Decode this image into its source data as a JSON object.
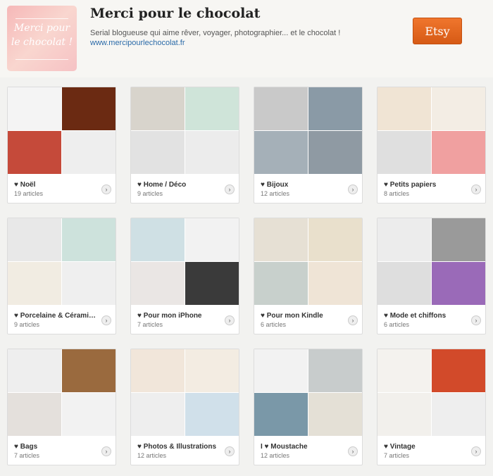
{
  "shop": {
    "avatar_text_1": "Merci pour",
    "avatar_text_2": "le chocolat !",
    "title": "Merci pour le chocolat",
    "description": "Serial blogueuse qui aime rêver, voyager, photographier... et le chocolat !",
    "link": "www.mercipourlechocolat.fr",
    "etsy_label": "Etsy"
  },
  "collections": [
    {
      "title": "♥ Noël",
      "count": "19 articles",
      "colors": [
        "#f4f4f4",
        "#6b2a12",
        "#c54a3a",
        "#eeeeee"
      ]
    },
    {
      "title": "♥ Home / Déco",
      "count": "9 articles",
      "colors": [
        "#d8d4cc",
        "#cfe4d9",
        "#e2e2e2",
        "#ececec"
      ]
    },
    {
      "title": "♥ Bijoux",
      "count": "12 articles",
      "colors": [
        "#c9c9c9",
        "#8a9aa6",
        "#a5b0b8",
        "#8f9aa3"
      ]
    },
    {
      "title": "♥ Petits papiers",
      "count": "8 articles",
      "colors": [
        "#f0e4d4",
        "#f3ede4",
        "#dfdfdf",
        "#f0a0a0"
      ]
    },
    {
      "title": "♥ Porcelaine & Cérami…",
      "count": "9 articles",
      "colors": [
        "#e8e8e8",
        "#cde2dc",
        "#f1ece2",
        "#efefef"
      ]
    },
    {
      "title": "♥ Pour mon iPhone",
      "count": "7 articles",
      "colors": [
        "#cfe0e4",
        "#f2f2f2",
        "#eae6e4",
        "#3a3a3a"
      ]
    },
    {
      "title": "♥ Pour mon Kindle",
      "count": "6 articles",
      "colors": [
        "#e6e0d4",
        "#e9e0cc",
        "#c8d0cc",
        "#efe4d6"
      ]
    },
    {
      "title": "♥ Mode et chiffons",
      "count": "6 articles",
      "colors": [
        "#ececec",
        "#9a9a9a",
        "#dedede",
        "#9a6ab8"
      ]
    },
    {
      "title": "♥ Bags",
      "count": "7 articles",
      "colors": [
        "#eeeeee",
        "#9a6a3e",
        "#e4e0dc",
        "#f2f2f2"
      ]
    },
    {
      "title": "♥ Photos & Illustrations",
      "count": "12 articles",
      "colors": [
        "#f1e6da",
        "#f3ece2",
        "#eeeeee",
        "#d0e0ea"
      ]
    },
    {
      "title": "I ♥ Moustache",
      "count": "12 articles",
      "colors": [
        "#f2f2f2",
        "#c8cccc",
        "#7a98a8",
        "#e4e0d6"
      ]
    },
    {
      "title": "♥ Vintage",
      "count": "7 articles",
      "colors": [
        "#f4f2ee",
        "#d24a2a",
        "#f2f0ec",
        "#eeeeee"
      ]
    }
  ]
}
